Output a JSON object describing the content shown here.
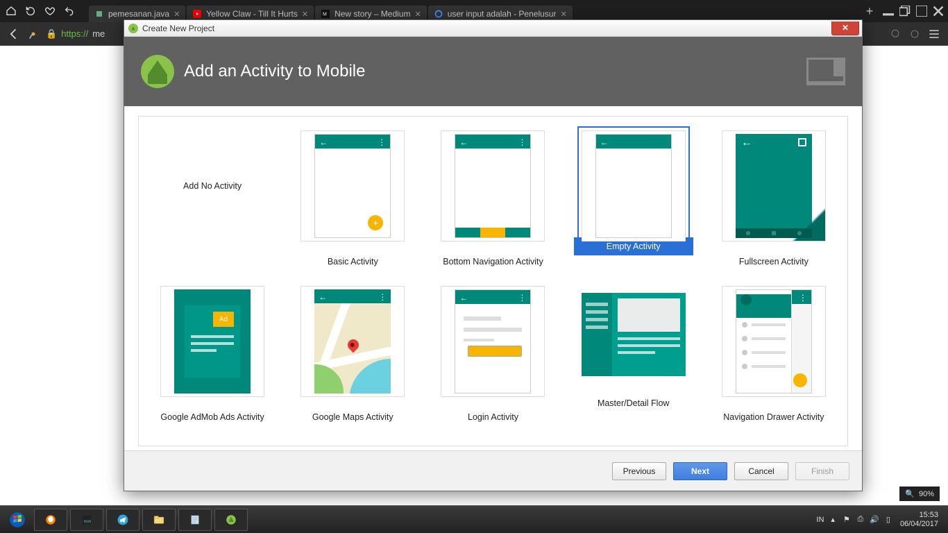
{
  "browser": {
    "url_protocol": "https://",
    "url_rest": "me",
    "tabs": [
      {
        "label": "pemesanan.java",
        "favicon": "code"
      },
      {
        "label": "Yellow Claw - Till It Hurts",
        "favicon": "youtube"
      },
      {
        "label": "New story – Medium",
        "favicon": "medium"
      },
      {
        "label": "user input adalah - Penelusur",
        "favicon": "google"
      }
    ]
  },
  "zoom": {
    "icon": "🔍",
    "value": "90%"
  },
  "dialog": {
    "title": "Create New Project",
    "header": "Add an Activity to Mobile",
    "templates": [
      {
        "id": "none",
        "label": "Add No Activity",
        "kind": "none",
        "selected": false
      },
      {
        "id": "basic",
        "label": "Basic Activity",
        "kind": "basic",
        "selected": false
      },
      {
        "id": "bottom",
        "label": "Bottom Navigation Activity",
        "kind": "bottomnav",
        "selected": false
      },
      {
        "id": "empty",
        "label": "Empty Activity",
        "kind": "empty",
        "selected": true
      },
      {
        "id": "full",
        "label": "Fullscreen Activity",
        "kind": "fullscreen",
        "selected": false
      },
      {
        "id": "admob",
        "label": "Google AdMob Ads Activity",
        "kind": "admob",
        "selected": false
      },
      {
        "id": "maps",
        "label": "Google Maps Activity",
        "kind": "maps",
        "selected": false
      },
      {
        "id": "login",
        "label": "Login Activity",
        "kind": "login",
        "selected": false
      },
      {
        "id": "master",
        "label": "Master/Detail Flow",
        "kind": "masterdetail",
        "selected": false
      },
      {
        "id": "nav",
        "label": "Navigation Drawer Activity",
        "kind": "navdrawer",
        "selected": false
      }
    ],
    "buttons": {
      "previous": "Previous",
      "next": "Next",
      "cancel": "Cancel",
      "finish": "Finish"
    }
  },
  "ad_badge": "Ad",
  "taskbar": {
    "lang": "IN",
    "time": "15:53",
    "date": "06/04/2017"
  }
}
